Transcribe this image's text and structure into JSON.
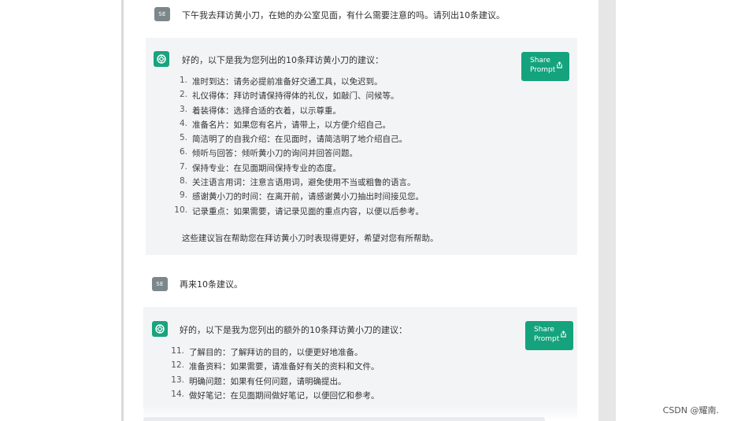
{
  "conversation": {
    "user_avatar_label": "SE",
    "share_button_label": [
      "Share",
      "Prompt"
    ],
    "messages": [
      {
        "role": "user",
        "text": "下午我去拜访黄小刀，在她的办公室见面，有什么需要注意的吗。请列出10条建议。"
      },
      {
        "role": "assistant",
        "intro": "好的，以下是我为您列出的10条拜访黄小刀的建议：",
        "items": [
          {
            "num": "1.",
            "text": "准时到达：请务必提前准备好交通工具，以免迟到。"
          },
          {
            "num": "2.",
            "text": "礼仪得体：拜访时请保持得体的礼仪，如敲门、问候等。"
          },
          {
            "num": "3.",
            "text": "着装得体：选择合适的衣着，以示尊重。"
          },
          {
            "num": "4.",
            "text": "准备名片：如果您有名片，请带上，以方便介绍自己。"
          },
          {
            "num": "5.",
            "text": "简洁明了的自我介绍：在见面时，请简洁明了地介绍自己。"
          },
          {
            "num": "6.",
            "text": "倾听与回答：倾听黄小刀的询问并回答问题。"
          },
          {
            "num": "7.",
            "text": "保持专业：在见面期间保持专业的态度。"
          },
          {
            "num": "8.",
            "text": "关注语言用词：注意言语用词，避免使用不当或粗鲁的语言。"
          },
          {
            "num": "9.",
            "text": "感谢黄小刀的时间：在离开前，请感谢黄小刀抽出时间接见您。"
          },
          {
            "num": "10.",
            "text": "记录重点：如果需要，请记录见面的重点内容，以便以后参考。"
          }
        ],
        "closing": "这些建议旨在帮助您在拜访黄小刀时表现得更好，希望对您有所帮助。"
      },
      {
        "role": "user",
        "text": "再来10条建议。"
      },
      {
        "role": "assistant",
        "intro": "好的，以下是我为您列出的额外的10条拜访黄小刀的建议：",
        "items": [
          {
            "num": "11.",
            "text": "了解目的：了解拜访的目的，以便更好地准备。"
          },
          {
            "num": "12.",
            "text": "准备资料：如果需要，请准备好有关的资料和文件。"
          },
          {
            "num": "13.",
            "text": "明确问题：如果有任何问题，请明确提出。"
          },
          {
            "num": "14.",
            "text": "做好笔记：在见面期间做好笔记，以便回忆和参考。"
          }
        ]
      }
    ]
  },
  "watermark": "CSDN @耀南.",
  "colors": {
    "assistant_bg": "#f3f4f6",
    "accent_green": "#14a37d",
    "avatar_gray": "#7b878b"
  },
  "icons": {
    "assistant_avatar": "openai-logo-icon",
    "share": "share-icon"
  }
}
